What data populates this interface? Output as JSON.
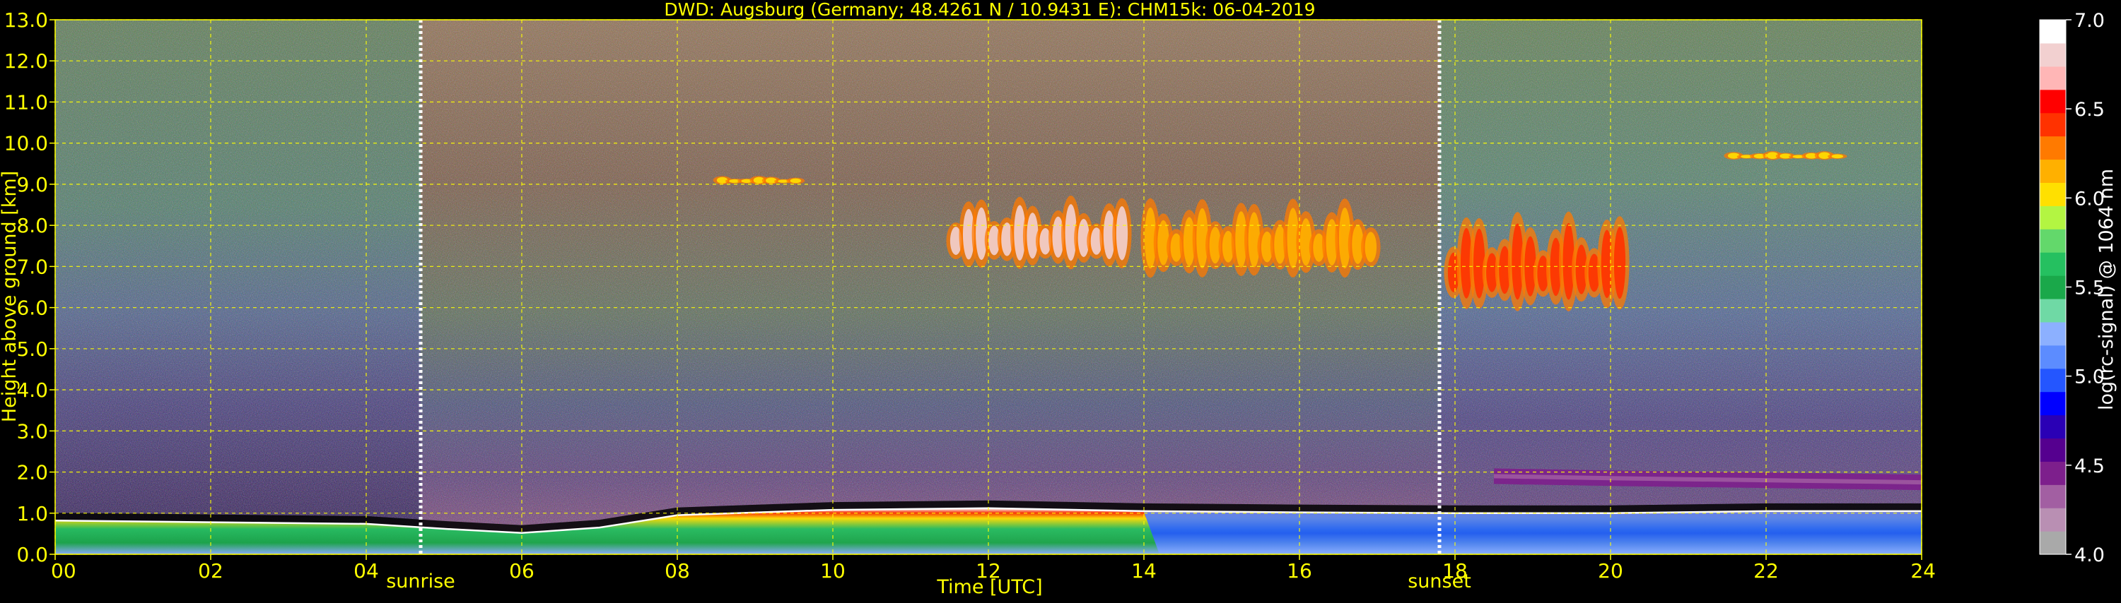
{
  "chart_data": {
    "type": "heatmap",
    "title": "DWD: Augsburg (Germany; 48.4261 N / 10.9431 E):    CHM15k: 06-04-2019",
    "xlabel": "Time [UTC]",
    "ylabel": "Height above ground [km]",
    "xlim": [
      0,
      24
    ],
    "ylim": [
      0,
      13
    ],
    "x_ticks": [
      0,
      2,
      4,
      6,
      8,
      10,
      12,
      14,
      16,
      18,
      20,
      22,
      24
    ],
    "x_tick_labels": [
      "00",
      "02",
      "04",
      "06",
      "08",
      "10",
      "12",
      "14",
      "16",
      "18",
      "20",
      "22",
      "24"
    ],
    "y_ticks": [
      0,
      1,
      2,
      3,
      4,
      5,
      6,
      7,
      8,
      9,
      10,
      11,
      12,
      13
    ],
    "y_tick_labels": [
      "0.0",
      "1.0",
      "2.0",
      "3.0",
      "4.0",
      "5.0",
      "6.0",
      "7.0",
      "8.0",
      "9.0",
      "10.0",
      "11.0",
      "12.0",
      "13.0"
    ],
    "grid": true,
    "annotations": [
      {
        "label": "sunrise",
        "x": 4.7
      },
      {
        "label": "sunset",
        "x": 17.8
      }
    ],
    "colorbar": {
      "label": "log(rc-signal) @ 1064 nm",
      "range": [
        4.0,
        7.0
      ],
      "ticks": [
        4.0,
        4.5,
        5.0,
        5.5,
        6.0,
        6.5,
        7.0
      ],
      "tick_labels": [
        "4.0",
        "4.5",
        "5.0",
        "5.5",
        "6.0",
        "6.5",
        "7.0"
      ]
    },
    "layers": [
      {
        "feature": "boundary-layer-top",
        "points": [
          [
            0,
            0.82
          ],
          [
            2,
            0.78
          ],
          [
            4,
            0.74
          ],
          [
            5,
            0.62
          ],
          [
            6,
            0.52
          ],
          [
            7,
            0.65
          ],
          [
            8,
            0.95
          ],
          [
            10,
            1.08
          ],
          [
            12,
            1.12
          ],
          [
            14,
            1.05
          ],
          [
            16,
            1.02
          ],
          [
            18,
            1.0
          ],
          [
            20,
            1.0
          ],
          [
            22,
            1.05
          ],
          [
            24,
            1.05
          ]
        ]
      },
      {
        "feature": "residual-aerosol-layer",
        "points": [
          [
            18.5,
            1.9
          ],
          [
            20,
            1.85
          ],
          [
            22,
            1.8
          ],
          [
            24,
            1.75
          ]
        ]
      },
      {
        "feature": "cirrus-cloud",
        "x_range": [
          11.5,
          13.8
        ],
        "height_range": [
          7.0,
          9.5
        ],
        "log_signal": 6.8
      },
      {
        "feature": "cirrus-cloud",
        "x_range": [
          14.0,
          17.0
        ],
        "height_range": [
          6.8,
          9.5
        ],
        "log_signal": 6.2
      },
      {
        "feature": "cirrus-cloud",
        "x_range": [
          17.9,
          20.2
        ],
        "height_range": [
          6.0,
          9.4
        ],
        "log_signal": 6.4
      },
      {
        "feature": "cirrus-cloud",
        "x_range": [
          21.5,
          23.0
        ],
        "height_range": [
          9.6,
          9.9
        ],
        "log_signal": 6.0
      },
      {
        "feature": "thin-cirrus",
        "x_range": [
          8.5,
          9.6
        ],
        "height_range": [
          9.0,
          9.3
        ],
        "log_signal": 6.0
      }
    ],
    "background_levels": [
      {
        "time_range": [
          0,
          4.7
        ],
        "signal_high": 5.2,
        "signal_low": 4.6
      },
      {
        "time_range": [
          4.7,
          17.8
        ],
        "signal_high": 6.5,
        "signal_low": 4.8
      },
      {
        "time_range": [
          17.8,
          24
        ],
        "signal_high": 5.4,
        "signal_low": 4.6
      }
    ],
    "colors": {
      "axis_text": "#ffff00",
      "grid": "#ffff00",
      "background": "#000000",
      "colormap": [
        "#a9a9a9",
        "#b98fb3",
        "#a25fa2",
        "#7d1f8c",
        "#55008f",
        "#2a00b5",
        "#0000ff",
        "#2456ff",
        "#5c8cff",
        "#8cb0ff",
        "#6fd9a5",
        "#1aa84a",
        "#25c060",
        "#63d86b",
        "#b3f542",
        "#ffe000",
        "#ffb000",
        "#ff7a00",
        "#ff3200",
        "#ff0000",
        "#ffb6b6",
        "#f2d0d0",
        "#ffffff"
      ]
    }
  }
}
